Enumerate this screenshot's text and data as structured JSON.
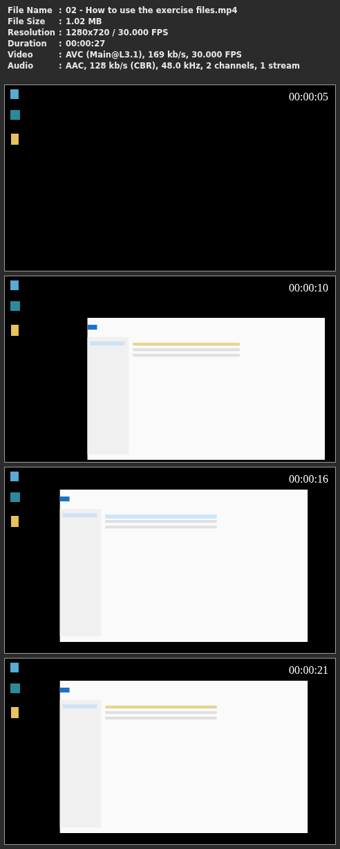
{
  "media_info": [
    {
      "label": "File Name",
      "separator": ":",
      "value": "02 - How to use the exercise files.mp4"
    },
    {
      "label": "File Size",
      "separator": ":",
      "value": "1.02 MB"
    },
    {
      "label": "Resolution",
      "separator": ":",
      "value": "1280x720 / 30.000 FPS"
    },
    {
      "label": "Duration",
      "separator": ":",
      "value": "00:00:27"
    },
    {
      "label": "Video",
      "separator": ":",
      "value": "AVC (Main@L3.1), 169 kb/s, 30.000 FPS"
    },
    {
      "label": "Audio",
      "separator": ":",
      "value": "AAC, 128 kb/s (CBR), 48.0 kHz, 2 channels, 1 stream"
    }
  ],
  "frames": [
    {
      "kind": "picture",
      "timestamp": "00:00:05"
    },
    {
      "kind": "picture",
      "timestamp": "00:00:10"
    },
    {
      "kind": "picture",
      "timestamp": "00:00:16"
    },
    {
      "kind": "picture",
      "timestamp": "00:00:21"
    }
  ]
}
